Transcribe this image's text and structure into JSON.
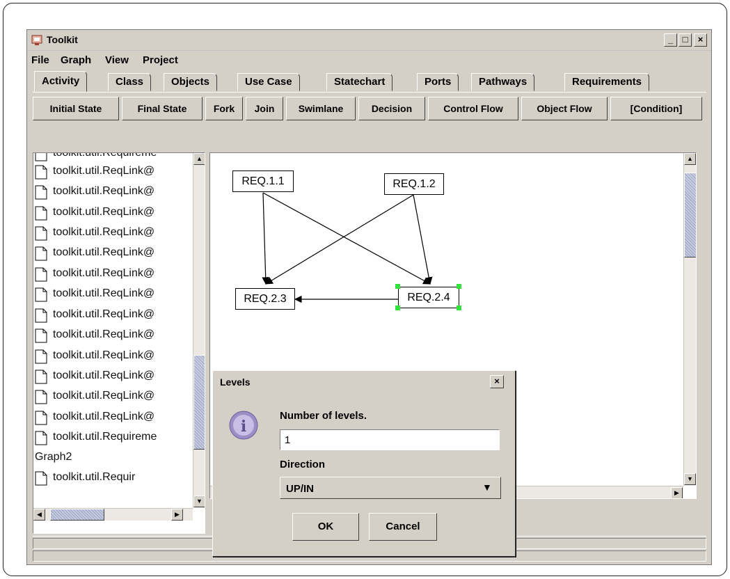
{
  "window": {
    "title": "Toolkit"
  },
  "menu": [
    "File",
    "Graph",
    "View",
    "Project"
  ],
  "tabs": [
    "Activity",
    "Class",
    "Objects",
    "Use Case",
    "Statechart",
    "Ports",
    "Pathways",
    "Requirements"
  ],
  "active_tab": "Activity",
  "toolbar": [
    "Initial State",
    "Final State",
    "Fork",
    "Join",
    "Swimlane",
    "Decision",
    "Control Flow",
    "Object Flow",
    "[Condition]"
  ],
  "tree": {
    "items": [
      "toolkit.util.Requireme",
      "toolkit.util.ReqLink@",
      "toolkit.util.ReqLink@",
      "toolkit.util.ReqLink@",
      "toolkit.util.ReqLink@",
      "toolkit.util.ReqLink@",
      "toolkit.util.ReqLink@",
      "toolkit.util.ReqLink@",
      "toolkit.util.ReqLink@",
      "toolkit.util.ReqLink@",
      "toolkit.util.ReqLink@",
      "toolkit.util.ReqLink@",
      "toolkit.util.ReqLink@",
      "toolkit.util.ReqLink@",
      "toolkit.util.Requireme"
    ],
    "group": "Graph2",
    "partial_item": "toolkit.util.Requir"
  },
  "graph": {
    "nodes": [
      "REQ.1.1",
      "REQ.1.2",
      "REQ.2.3",
      "REQ.2.4"
    ],
    "selected": "REQ.2.4",
    "edges": [
      {
        "from": "REQ.1.1",
        "to": "REQ.2.3"
      },
      {
        "from": "REQ.1.1",
        "to": "REQ.2.4"
      },
      {
        "from": "REQ.1.2",
        "to": "REQ.2.3"
      },
      {
        "from": "REQ.1.2",
        "to": "REQ.2.4"
      },
      {
        "from": "REQ.2.4",
        "to": "REQ.2.3"
      }
    ]
  },
  "dialog": {
    "title": "Levels",
    "levels_label": "Number of levels.",
    "levels_value": "1",
    "direction_label": "Direction",
    "direction_value": "UP/IN",
    "ok": "OK",
    "cancel": "Cancel"
  },
  "colors": {
    "selection_handle": "#31e33a",
    "window_bg": "#d4d0c8",
    "info_icon": "#9b8ec4"
  }
}
